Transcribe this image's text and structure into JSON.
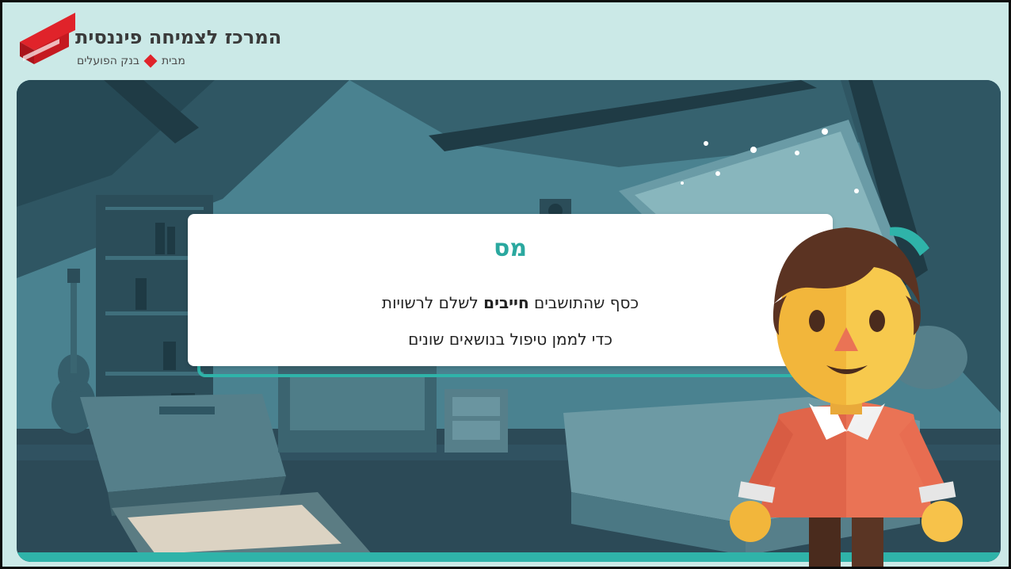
{
  "logo": {
    "title": "המרכז לצמיחה פיננסית",
    "sub_prefix": "מבית",
    "sub_bank": "בנק הפועלים"
  },
  "card": {
    "title": "מס",
    "line1_before": "כסף שהתושבים ",
    "line1_bold": "חייבים",
    "line1_after": " לשלם לרשויות",
    "line2": "כדי לממן טיפול בנושאים שונים"
  },
  "colors": {
    "accent": "#2aa89f",
    "brand_red": "#e0232a",
    "frame_bg": "#cbe9e7"
  },
  "icons": {
    "logo": "red-ribbon-logo-icon",
    "bullet": "red-diamond-icon"
  }
}
